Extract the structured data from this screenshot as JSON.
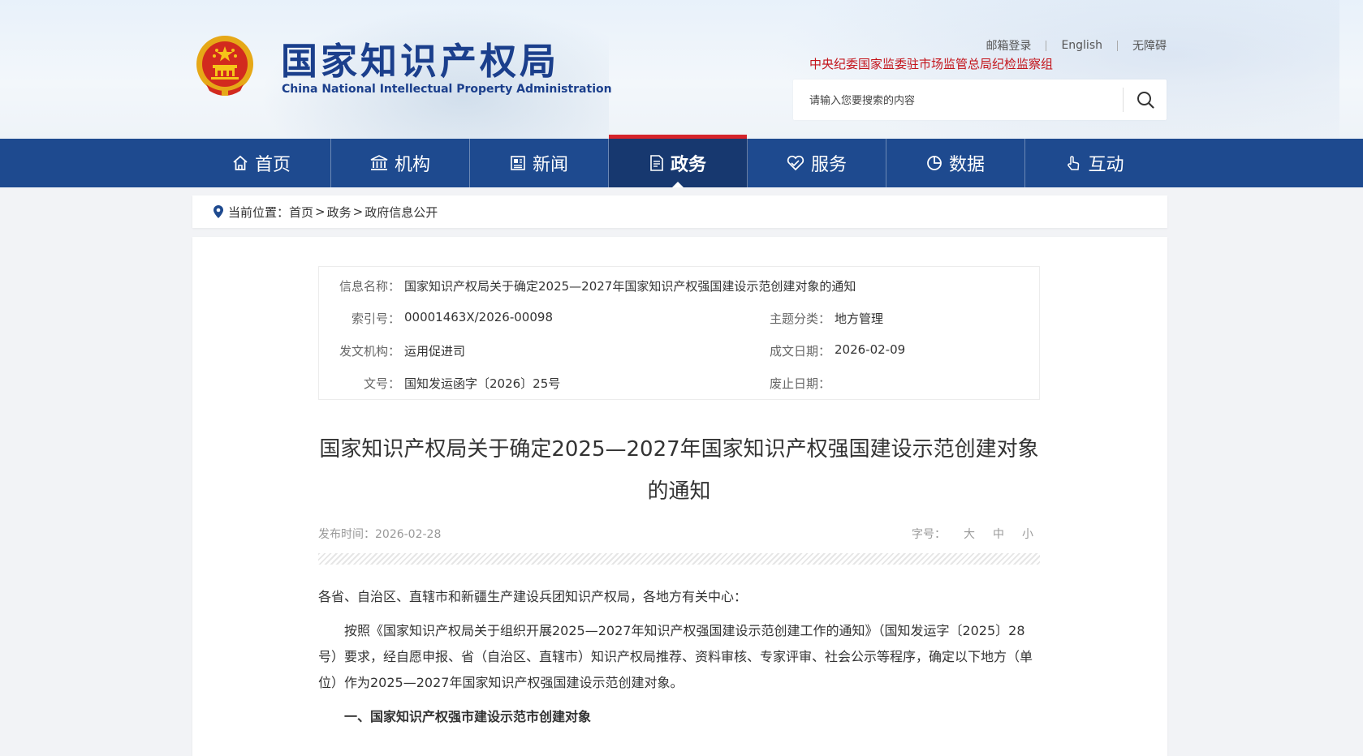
{
  "header": {
    "logo_cn": "国家知识产权局",
    "logo_en": "China National Intellectual Property Administration",
    "links": [
      "邮箱登录",
      "English",
      "无障碍"
    ],
    "supervision": "中央纪委国家监委驻市场监管总局纪检监察组",
    "search_placeholder": "请输入您要搜索的内容"
  },
  "nav": {
    "items": [
      {
        "label": "首页",
        "icon": "home-icon"
      },
      {
        "label": "机构",
        "icon": "institution-icon"
      },
      {
        "label": "新闻",
        "icon": "news-icon"
      },
      {
        "label": "政务",
        "icon": "government-affairs-icon",
        "active": true
      },
      {
        "label": "服务",
        "icon": "service-icon"
      },
      {
        "label": "数据",
        "icon": "data-icon"
      },
      {
        "label": "互动",
        "icon": "interaction-icon"
      }
    ]
  },
  "breadcrumb": {
    "label": "当前位置：",
    "items": [
      "首页",
      "政务",
      "政府信息公开"
    ],
    "sep": ">"
  },
  "meta": {
    "info_name_label": "信息名称：",
    "info_name": "国家知识产权局关于确定2025—2027年国家知识产权强国建设示范创建对象的通知",
    "index_label": "索引号：",
    "index": "00001463X/2026-00098",
    "topic_label": "主题分类：",
    "topic": "地方管理",
    "issuer_label": "发文机构：",
    "issuer": "运用促进司",
    "date_label": "成文日期：",
    "date": "2026-02-09",
    "docno_label": "文号：",
    "docno": "国知发运函字〔2026〕25号",
    "abolish_label": "废止日期：",
    "abolish": ""
  },
  "article": {
    "title_line1": "国家知识产权局关于确定2025—2027年国家知识产权强国建设示范创建对象",
    "title_line2": "的通知",
    "publish": "发布时间：2026-02-28",
    "fontsize_label": "字号：",
    "fontsize_options": [
      "大",
      "中",
      "小"
    ],
    "salutation": "各省、自治区、直辖市和新疆生产建设兵团知识产权局，各地方有关中心：",
    "para1": "按照《国家知识产权局关于组织开展2025—2027年知识产权强国建设示范创建工作的通知》（国知发运字〔2025〕28号）要求，经自愿申报、省（自治区、直辖市）知识产权局推荐、资料审核、专家评审、社会公示等程序，确定以下地方（单位）作为2025—2027年国家知识产权强国建设示范创建对象。",
    "heading1": "一、国家知识产权强市建设示范市创建对象"
  },
  "colors": {
    "nav_bg": "#1e4a8f",
    "nav_active": "#17386f",
    "accent_red": "#d5242b",
    "logo_blue": "#1b3f8c",
    "supervision_red": "#c3131a"
  }
}
